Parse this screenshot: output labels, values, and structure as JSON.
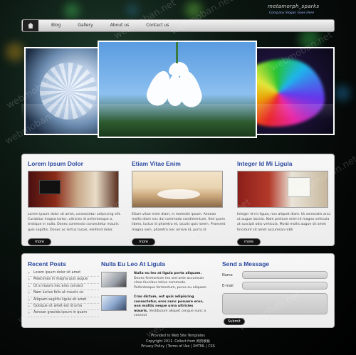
{
  "header": {
    "site_title": "metamorph_sparks",
    "slogan": "Company Slogan Goes Here"
  },
  "nav": {
    "items": [
      "Blog",
      "Gallery",
      "About us",
      "Contact us"
    ]
  },
  "features": [
    {
      "title": "Lorem Ipsum Dolor",
      "text": "Lorem ipsum dolor sit amet, consectetur adipiscing elit. Curabitur magna tortor, ultricies id pellentesque a, tristique in nulla. Donec commodo consectetur mauris quis sagittis. Donec ac lectus turpis, eleifend dolor.",
      "more": "more"
    },
    {
      "title": "Etiam Vitae Enim",
      "text": "Etiam vitae enim diam, in molestie ipsum. Aenean mollis diam nec dui commodo condimentum. Sed quam libero, luctus id pharetra et, iaculis quis lorem. Praesent magna sem, pharetra nec ornare id, porta id",
      "more": "more"
    },
    {
      "title": "Integer Id Mi Ligula",
      "text": "Integer id mi ligula, non aliquet diam. Ut venenatis arcu ut augue lacinia. Nam pretium enim id magna vehicula at suscipit odio vehicula. Morbi mollis augue sit amet tincidunt sit amet accumsan nibh",
      "more": "more"
    }
  ],
  "recent_posts": {
    "title": "Recent Posts",
    "items": [
      "Lorem ipsum dolor sit amet",
      "Maecenas in magna quis augue",
      "Ut a mauris nec eros consect",
      "Nam luctus felis at mauris co",
      "Aliquam sagittis ligula sit amet",
      "Quisque sit amet est id urna",
      "Aenean gravida ipsum in quam"
    ]
  },
  "news": {
    "title": "Nulla Eu Leo At Ligula",
    "items": [
      {
        "bold": "Nulla eu leo at ligula porta aliquam.",
        "text": " Donec fermentum leo sed ante accumsan vitae faucibus tellus commodo. Pellentesque fermentum, purus eu aliquam."
      },
      {
        "bold": "Cras dictum, est quis adipiscing consectetur, eros nunc posuere eros, non mattis neque urna ultricies mauris.",
        "text": " Vestibulum aliquet congue nunc a consect"
      }
    ]
  },
  "contact": {
    "title": "Send a Message",
    "name_label": "Name",
    "email_label": "E-mail",
    "submit": "Submit"
  },
  "footer": {
    "line1": "Provided to Web Site Templates",
    "line2": "Copyright 2011. Collect from 网页模板",
    "line3": "Privacy Policy | Terms of Use | XHTML | CSS"
  },
  "watermark": "webmoban.net"
}
